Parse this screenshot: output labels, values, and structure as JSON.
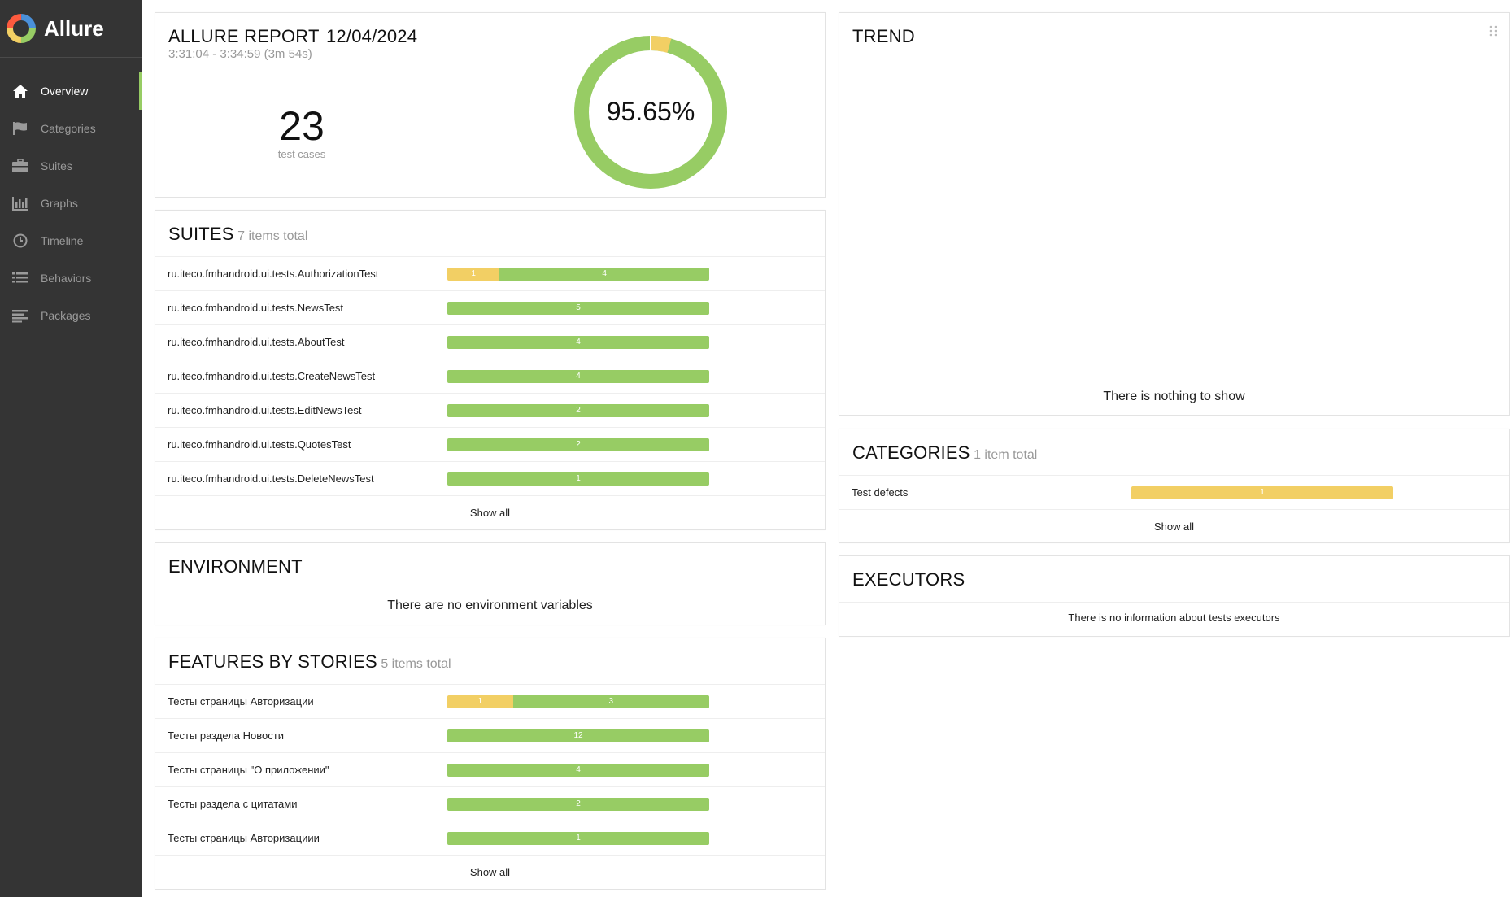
{
  "brand": {
    "name": "Allure"
  },
  "nav": [
    {
      "label": "Overview",
      "icon": "home-icon",
      "active": true
    },
    {
      "label": "Categories",
      "icon": "flag-icon",
      "active": false
    },
    {
      "label": "Suites",
      "icon": "briefcase-icon",
      "active": false
    },
    {
      "label": "Graphs",
      "icon": "bar-chart-icon",
      "active": false
    },
    {
      "label": "Timeline",
      "icon": "clock-icon",
      "active": false
    },
    {
      "label": "Behaviors",
      "icon": "list-icon",
      "active": false
    },
    {
      "label": "Packages",
      "icon": "align-left-icon",
      "active": false
    }
  ],
  "summary": {
    "title": "ALLURE REPORT",
    "date": "12/04/2024",
    "time_range": "3:31:04 - 3:34:59 (3m 54s)",
    "test_count": "23",
    "test_count_label": "test cases",
    "percent": "95.65%",
    "passed_fraction": 0.9565
  },
  "suites": {
    "title": "SUITES",
    "subtitle": "7 items total",
    "rows": [
      {
        "name": "ru.iteco.fmhandroid.ui.tests.AuthorizationTest",
        "segments": [
          {
            "count": "1",
            "status": "broken"
          },
          {
            "count": "4",
            "status": "passed"
          }
        ]
      },
      {
        "name": "ru.iteco.fmhandroid.ui.tests.NewsTest",
        "segments": [
          {
            "count": "5",
            "status": "passed"
          }
        ]
      },
      {
        "name": "ru.iteco.fmhandroid.ui.tests.AboutTest",
        "segments": [
          {
            "count": "4",
            "status": "passed"
          }
        ]
      },
      {
        "name": "ru.iteco.fmhandroid.ui.tests.CreateNewsTest",
        "segments": [
          {
            "count": "4",
            "status": "passed"
          }
        ]
      },
      {
        "name": "ru.iteco.fmhandroid.ui.tests.EditNewsTest",
        "segments": [
          {
            "count": "2",
            "status": "passed"
          }
        ]
      },
      {
        "name": "ru.iteco.fmhandroid.ui.tests.QuotesTest",
        "segments": [
          {
            "count": "2",
            "status": "passed"
          }
        ]
      },
      {
        "name": "ru.iteco.fmhandroid.ui.tests.DeleteNewsTest",
        "segments": [
          {
            "count": "1",
            "status": "passed"
          }
        ]
      }
    ],
    "show_all": "Show all"
  },
  "environment": {
    "title": "ENVIRONMENT",
    "message": "There are no environment variables"
  },
  "features": {
    "title": "FEATURES BY STORIES",
    "subtitle": "5 items total",
    "rows": [
      {
        "name": "Тесты страницы Авторизации",
        "segments": [
          {
            "count": "1",
            "status": "broken"
          },
          {
            "count": "3",
            "status": "passed"
          }
        ]
      },
      {
        "name": "Тесты раздела Новости",
        "segments": [
          {
            "count": "12",
            "status": "passed"
          }
        ]
      },
      {
        "name": "Тесты страницы \"О приложении\"",
        "segments": [
          {
            "count": "4",
            "status": "passed"
          }
        ]
      },
      {
        "name": "Тесты раздела с цитатами",
        "segments": [
          {
            "count": "2",
            "status": "passed"
          }
        ]
      },
      {
        "name": "Тесты страницы Авторизациии",
        "segments": [
          {
            "count": "1",
            "status": "passed"
          }
        ]
      }
    ],
    "show_all": "Show all"
  },
  "trend": {
    "title": "TREND",
    "message": "There is nothing to show"
  },
  "categories": {
    "title": "CATEGORIES",
    "subtitle": "1 item total",
    "rows": [
      {
        "name": "Test defects",
        "segments": [
          {
            "count": "1",
            "status": "broken"
          }
        ]
      }
    ],
    "show_all": "Show all"
  },
  "executors": {
    "title": "EXECUTORS",
    "message": "There is no information about tests executors"
  },
  "colors": {
    "passed": "#97cc64",
    "broken": "#f2cf64",
    "sidebar": "#343434"
  }
}
